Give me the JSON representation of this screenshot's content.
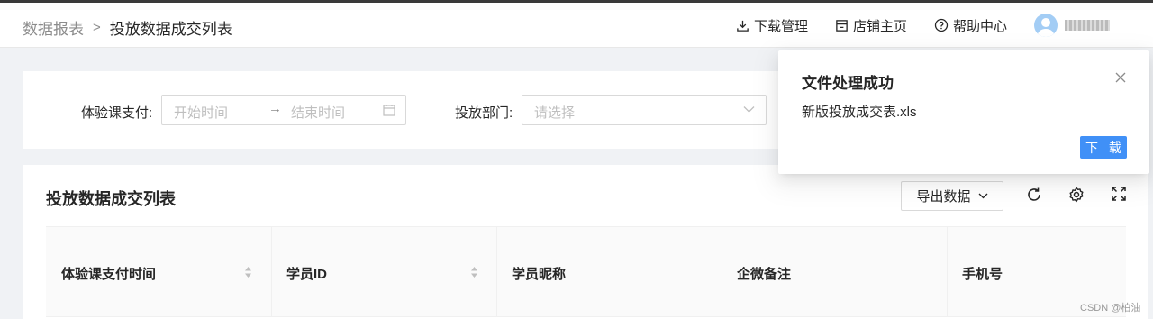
{
  "header": {
    "breadcrumb_parent": "数据报表",
    "breadcrumb_sep": ">",
    "breadcrumb_current": "投放数据成交列表",
    "download_manage": "下载管理",
    "store_home": "店铺主页",
    "help_center": "帮助中心"
  },
  "filter": {
    "pay_label": "体验课支付",
    "pay_colon": ":",
    "start_placeholder": "开始时间",
    "end_placeholder": "结束时间",
    "range_arrow": "→",
    "dept_label": "投放部门",
    "dept_colon": ":",
    "dept_placeholder": "请选择"
  },
  "table": {
    "title": "投放数据成交列表",
    "export_label": "导出数据",
    "columns": [
      "体验课支付时间",
      "学员ID",
      "学员昵称",
      "企微备注",
      "手机号"
    ]
  },
  "notification": {
    "title": "文件处理成功",
    "description": "新版投放成交表.xls",
    "download_label": "下 载"
  },
  "watermark": "CSDN @柏油",
  "colors": {
    "primary": "#4090f7",
    "avatar": "#a3cdf5"
  }
}
